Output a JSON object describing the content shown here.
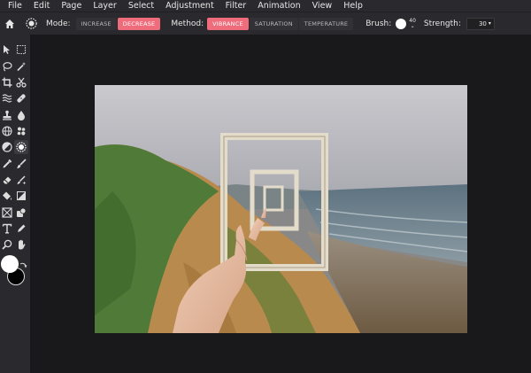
{
  "menu": [
    "File",
    "Edit",
    "Page",
    "Layer",
    "Select",
    "Adjustment",
    "Filter",
    "Animation",
    "View",
    "Help"
  ],
  "options": {
    "mode_label": "Mode:",
    "mode_buttons": [
      "INCREASE",
      "DECREASE"
    ],
    "mode_active": "DECREASE",
    "method_label": "Method:",
    "method_buttons": [
      "VIBRANCE",
      "SATURATION",
      "TEMPERATURE"
    ],
    "method_active": "VIBRANCE",
    "brush_label": "Brush:",
    "brush_size": "40",
    "strength_label": "Strength:",
    "strength_value": "30"
  },
  "colors": {
    "accent": "#ee6c7c",
    "primary_color": "#ffffff",
    "secondary_color": "#000000"
  },
  "tools": [
    "select-arrow-icon",
    "marquee-select-icon",
    "lasso-icon",
    "magic-wand-icon",
    "crop-icon",
    "scissors-icon",
    "liquify-icon",
    "healing-bandage-icon",
    "clone-stamp-icon",
    "blur-drop-icon",
    "sponge-globe-icon",
    "smudge-blob-icon",
    "dodge-burn-icon",
    "saturation-sponge-icon",
    "color-picker-icon",
    "brush-icon",
    "eraser-icon",
    "smart-brush-icon",
    "paint-bucket-icon",
    "gradient-icon",
    "image-placeholder-icon",
    "shape-icon",
    "text-icon",
    "pen-icon",
    "zoom-icon",
    "hand-icon"
  ]
}
